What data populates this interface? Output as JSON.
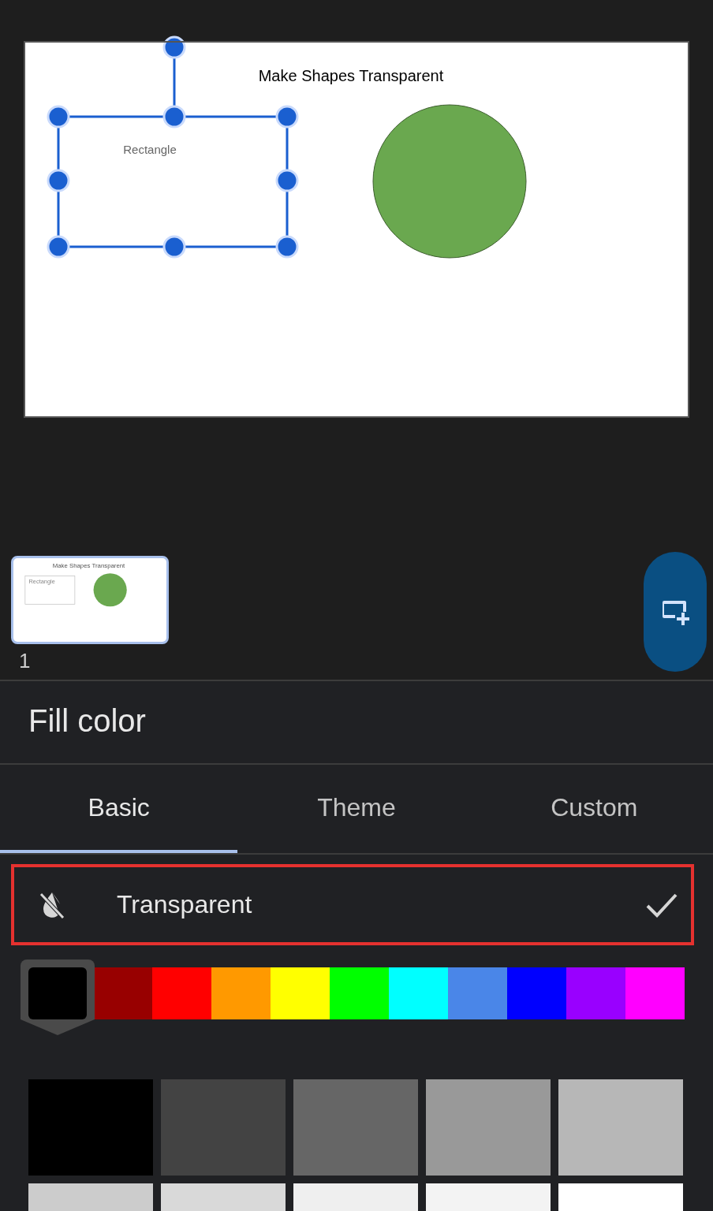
{
  "slide": {
    "title": "Make Shapes Transparent",
    "shapes": [
      {
        "kind": "rectangle",
        "label": "Rectangle",
        "selected": true
      },
      {
        "kind": "circle",
        "color": "#6aa84f",
        "selected": false
      }
    ]
  },
  "thumbnails": [
    {
      "number": "1",
      "title": "Make Shapes Transparent",
      "shape_label": "Rectangle",
      "selected": true
    }
  ],
  "fill_panel": {
    "title": "Fill color",
    "tabs": [
      {
        "label": "Basic",
        "selected": true
      },
      {
        "label": "Theme",
        "selected": false
      },
      {
        "label": "Custom",
        "selected": false
      }
    ],
    "transparent": {
      "label": "Transparent",
      "checked": true,
      "highlighted": true
    },
    "hues": [
      {
        "color": "#000000",
        "selected": true
      },
      {
        "color": "#980000",
        "selected": false
      },
      {
        "color": "#ff0000",
        "selected": false
      },
      {
        "color": "#ff9900",
        "selected": false
      },
      {
        "color": "#ffff00",
        "selected": false
      },
      {
        "color": "#00ff00",
        "selected": false
      },
      {
        "color": "#00ffff",
        "selected": false
      },
      {
        "color": "#4a86e8",
        "selected": false
      },
      {
        "color": "#0000ff",
        "selected": false
      },
      {
        "color": "#9900ff",
        "selected": false
      },
      {
        "color": "#ff00ff",
        "selected": false
      }
    ],
    "swatches": [
      {
        "color": "#000000"
      },
      {
        "color": "#434343"
      },
      {
        "color": "#666666"
      },
      {
        "color": "#999999"
      },
      {
        "color": "#b7b7b7"
      },
      {
        "color": "#cccccc"
      },
      {
        "color": "#d9d9d9"
      },
      {
        "color": "#efefef"
      },
      {
        "color": "#f3f3f3"
      },
      {
        "color": "#ffffff"
      }
    ]
  }
}
